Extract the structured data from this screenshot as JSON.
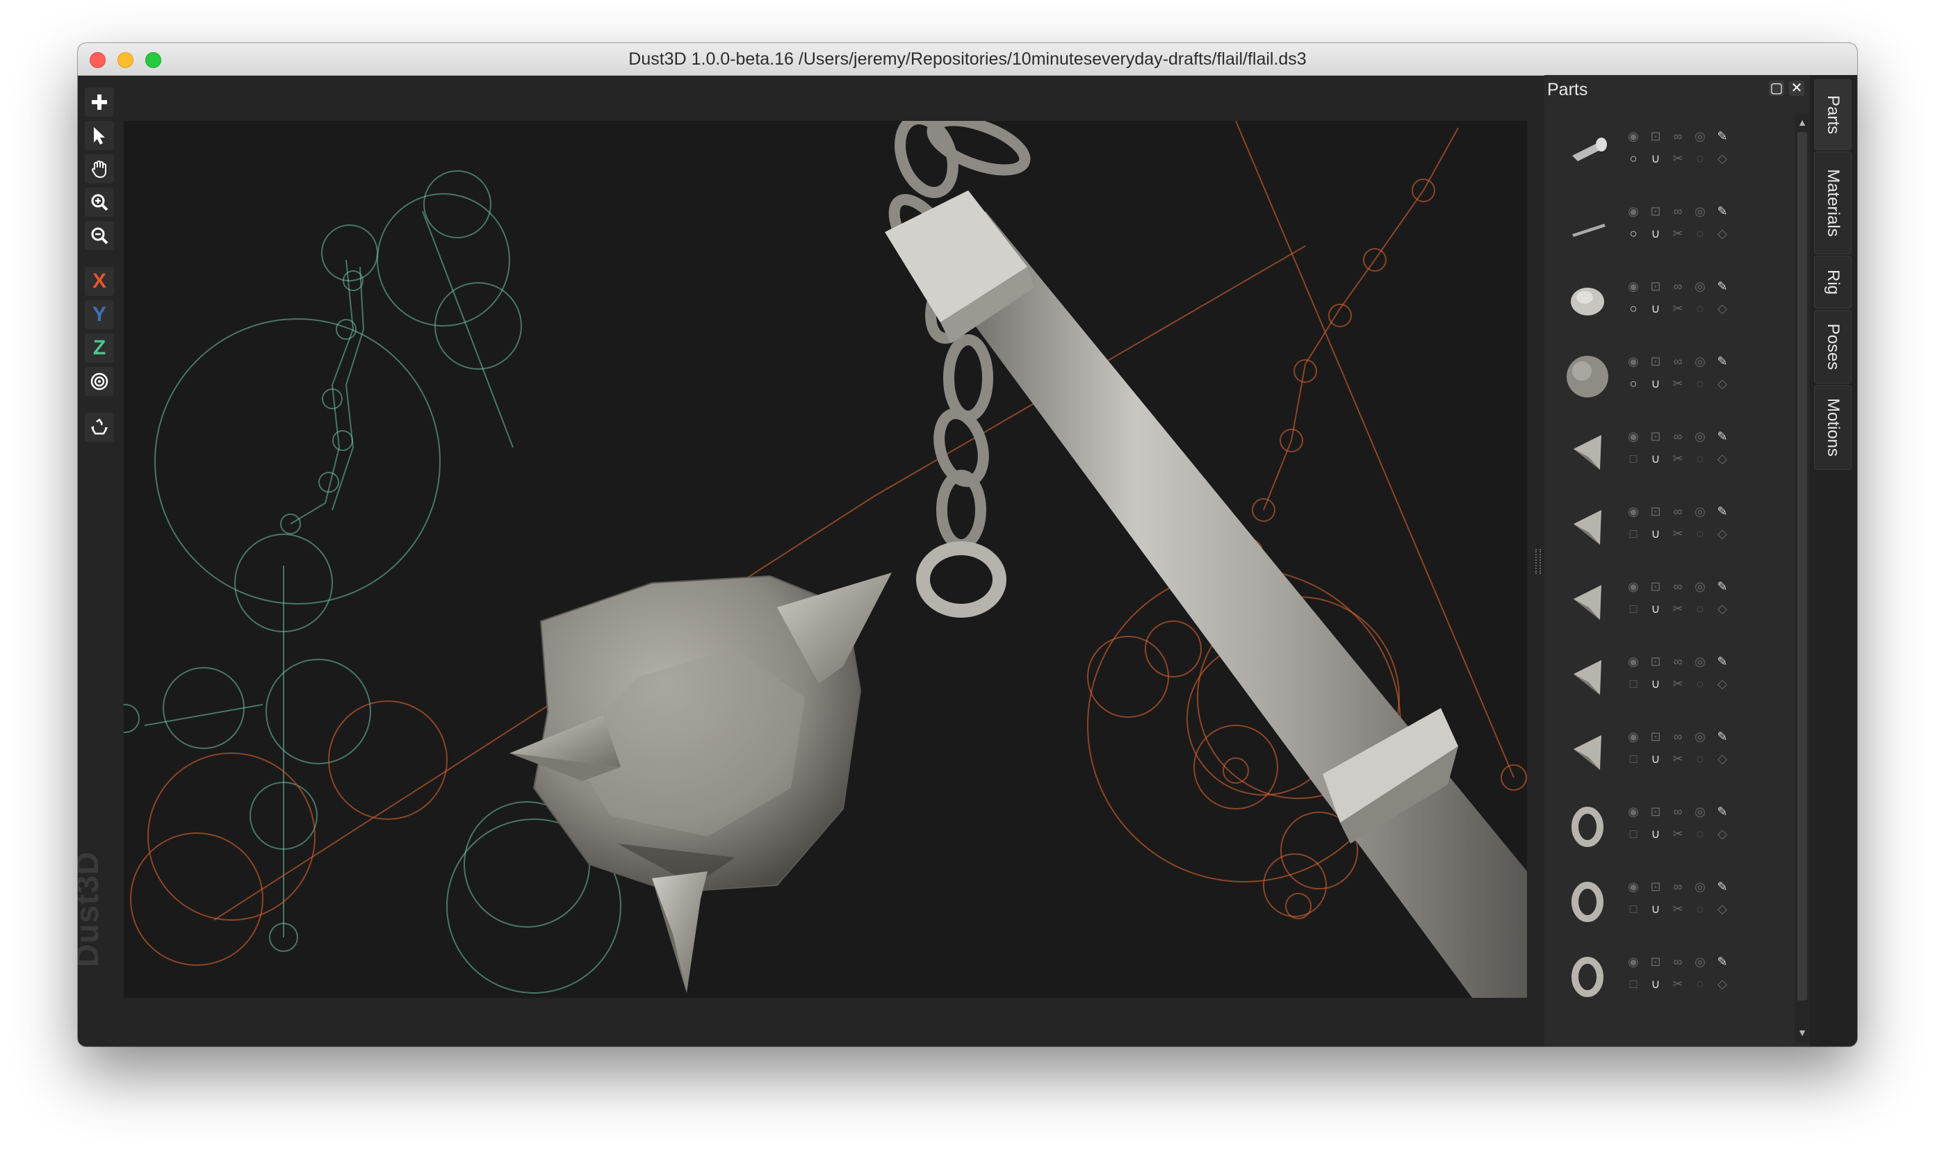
{
  "window": {
    "title": "Dust3D 1.0.0-beta.16 /Users/jeremy/Repositories/10minuteseveryday-drafts/flail/flail.ds3"
  },
  "toolbar": {
    "items": [
      {
        "name": "add",
        "icon": "plus-icon"
      },
      {
        "name": "select",
        "icon": "cursor-icon"
      },
      {
        "name": "pan",
        "icon": "hand-icon"
      },
      {
        "name": "zoom-in",
        "icon": "zoom-in-icon"
      },
      {
        "name": "zoom-out",
        "icon": "zoom-out-icon"
      },
      {
        "name": "x-axis",
        "label": "X",
        "color": "#e6552a"
      },
      {
        "name": "y-axis",
        "label": "Y",
        "color": "#3f6fb5"
      },
      {
        "name": "z-axis",
        "label": "Z",
        "color": "#4fc48a"
      },
      {
        "name": "radius",
        "icon": "target-icon"
      },
      {
        "name": "regenerate",
        "icon": "recycle-icon"
      }
    ]
  },
  "viewport": {
    "watermark": "Dust3D",
    "colors": {
      "background": "#1a1a1a",
      "left_skeleton": "#6fc3a3",
      "right_skeleton": "#d9622e",
      "mesh": "#8f8c86"
    }
  },
  "parts_panel": {
    "title": "Parts",
    "float_icon": "float-icon",
    "close_icon": "close-icon",
    "parts": [
      {
        "shape": "handle-cap",
        "unlinked": false
      },
      {
        "shape": "rod",
        "unlinked": false
      },
      {
        "shape": "blob",
        "unlinked": false
      },
      {
        "shape": "sphere",
        "unlinked": false
      },
      {
        "shape": "spike",
        "unlinked": true
      },
      {
        "shape": "spike",
        "unlinked": true
      },
      {
        "shape": "spike",
        "unlinked": true
      },
      {
        "shape": "spike",
        "unlinked": true
      },
      {
        "shape": "spike",
        "unlinked": true
      },
      {
        "shape": "ring",
        "unlinked": true
      },
      {
        "shape": "ring",
        "unlinked": true
      },
      {
        "shape": "ring",
        "unlinked": true
      }
    ]
  },
  "side_tabs": [
    "Parts",
    "Materials",
    "Rig",
    "Poses",
    "Motions"
  ]
}
